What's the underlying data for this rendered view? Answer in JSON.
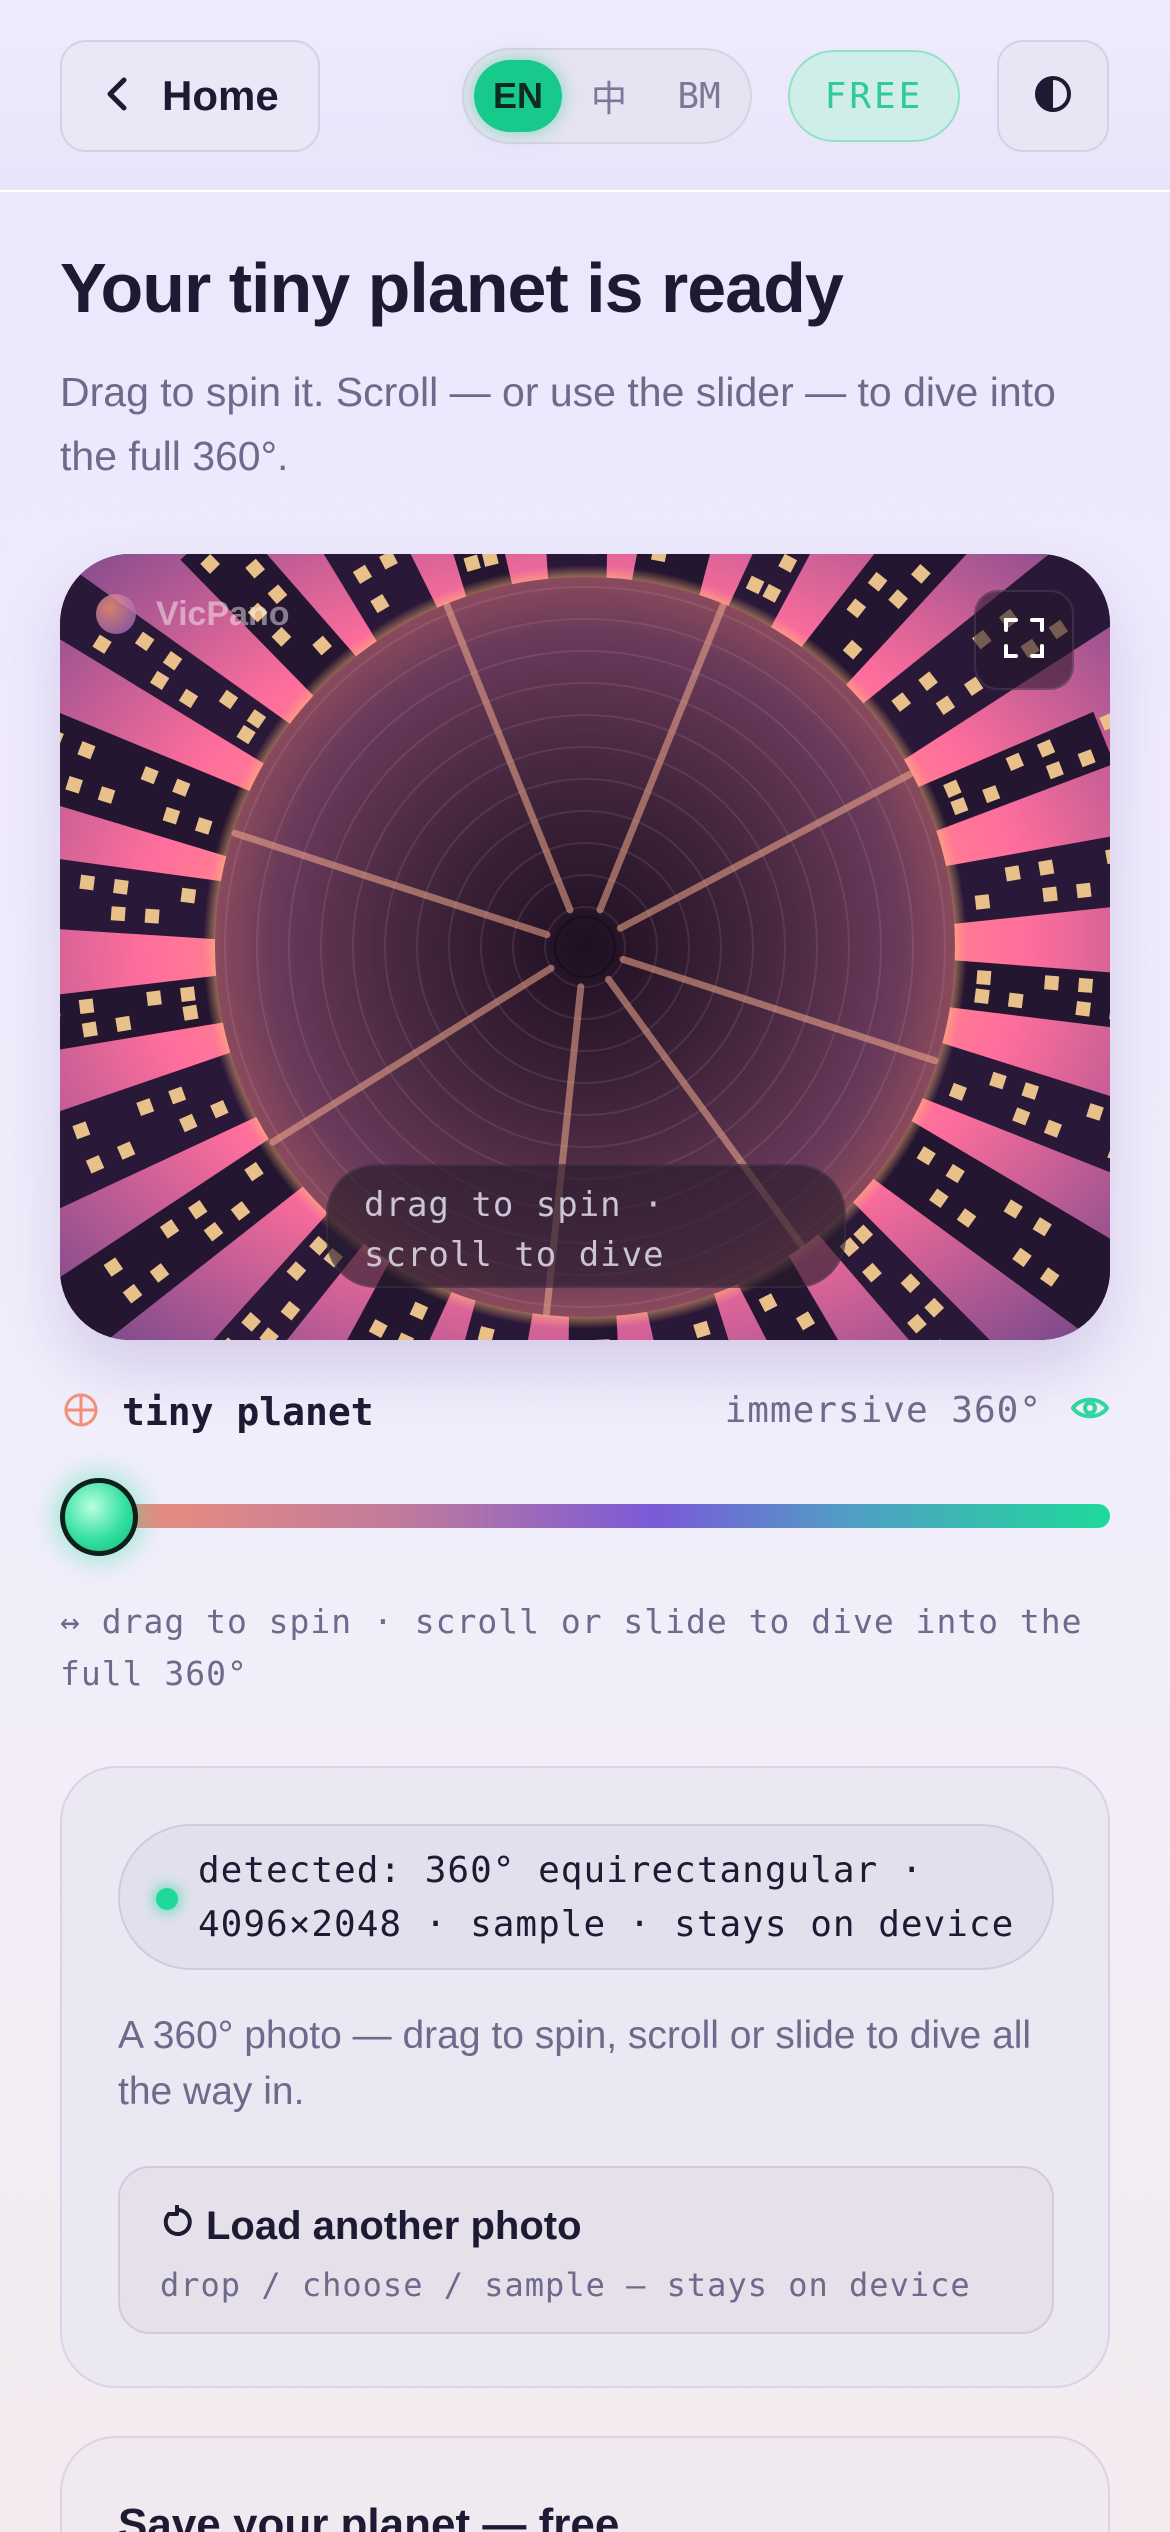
{
  "header": {
    "home_label": "Home",
    "languages": [
      "EN",
      "中",
      "BM"
    ],
    "active_language": "EN",
    "plan_badge": "FREE"
  },
  "page": {
    "title": "Your tiny planet is ready",
    "subtitle": "Drag to spin it. Scroll — or use the slider — to dive into the full 360°."
  },
  "viewer": {
    "brand": "VicPano",
    "hint_line1": "drag to spin ·",
    "hint_line2": "scroll to dive"
  },
  "mode": {
    "left_label": "tiny planet",
    "right_label": "immersive 360°",
    "dive_level": 0
  },
  "slider_hint": "↔ drag to spin · scroll or slide to dive into the full 360°",
  "info_card": {
    "detected_line1": "detected: 360° equirectangular ·",
    "detected_line2": "4096×2048 · sample · stays on device",
    "description": "A 360° photo — drag to spin, scroll or slide to dive all the way in.",
    "load_title": "Load another photo",
    "load_subtitle": "drop / choose / sample — stays on device"
  },
  "save_card": {
    "title": "Save your planet — free"
  },
  "colors": {
    "accent_green": "#1fd99a",
    "accent_purple": "#7a5ad8",
    "accent_coral": "#f0907a",
    "text_dark": "#1d1a33",
    "text_muted": "#6e6a8c"
  },
  "icons": {
    "home": "chevron-left-icon",
    "theme": "half-circle-contrast-icon",
    "fullscreen": "fullscreen-icon",
    "tiny_planet": "crosshair-circle-icon",
    "immersive": "eye-icon",
    "reload": "refresh-icon"
  }
}
